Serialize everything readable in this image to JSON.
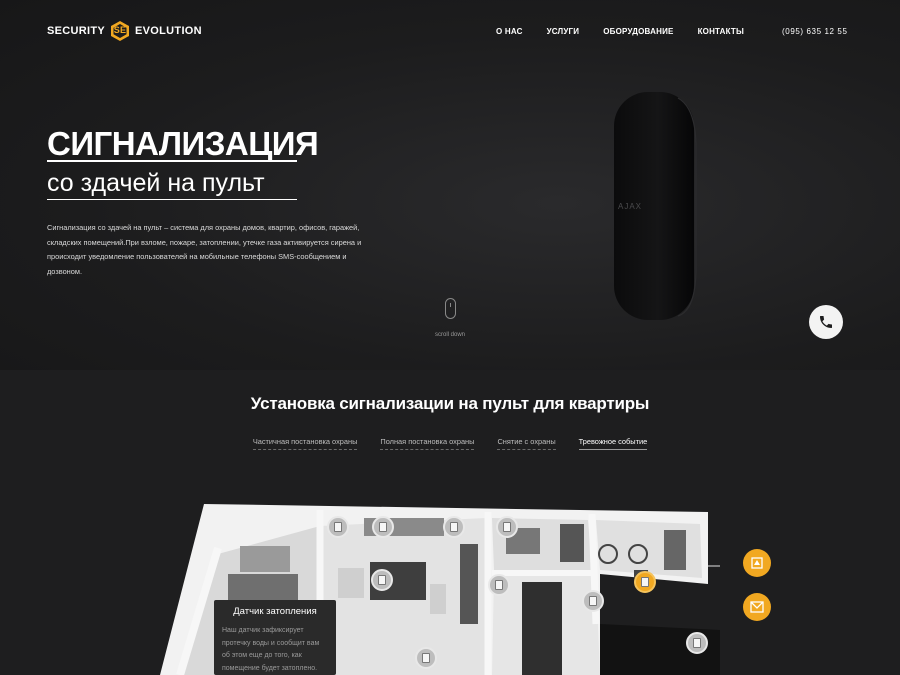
{
  "brand": {
    "name_left": "SECURITY",
    "mark": "SE",
    "name_right": "EVOLUTION"
  },
  "nav": {
    "items": [
      {
        "label": "О НАС"
      },
      {
        "label": "УСЛУГИ"
      },
      {
        "label": "ОБОРУДОВАНИЕ"
      },
      {
        "label": "КОНТАКТЫ"
      }
    ]
  },
  "header": {
    "phone": "(095) 635 12 55"
  },
  "hero": {
    "title": "СИГНАЛИЗАЦИЯ",
    "subtitle": "со здачей на пульт",
    "description": "Сигнализация со здачей на пульт  – система для охраны домов, квартир, офисов, гаражей, складских помещений.При взломе, пожаре, затоплении, утечке газа активируется сирена и происходит уведомление пользователей на мобильные телефоны SMS-сообщением и дозвоном.",
    "device_label": "AJAX",
    "scroll_label": "scroll down"
  },
  "install": {
    "title": "Установка сигнализации на пульт для квартиры",
    "tabs": [
      {
        "label": "Частичная постановка охраны",
        "active": false
      },
      {
        "label": "Полная постановка охраны",
        "active": false
      },
      {
        "label": "Снятие с охраны",
        "active": false
      },
      {
        "label": "Тревожное событие",
        "active": true
      }
    ],
    "tooltip": {
      "title": "Датчик затопления",
      "text": "Наш датчик зафиксирует протечку воды и сообщит вам об этом еще до того, как помещение будет затоплено."
    }
  },
  "colors": {
    "accent": "#f1a821",
    "background": "#1e1e1f",
    "text": "#ffffff"
  },
  "icons": [
    "phone-icon",
    "mouse-icon",
    "sensor-icon",
    "alarm-icon",
    "mail-icon"
  ]
}
